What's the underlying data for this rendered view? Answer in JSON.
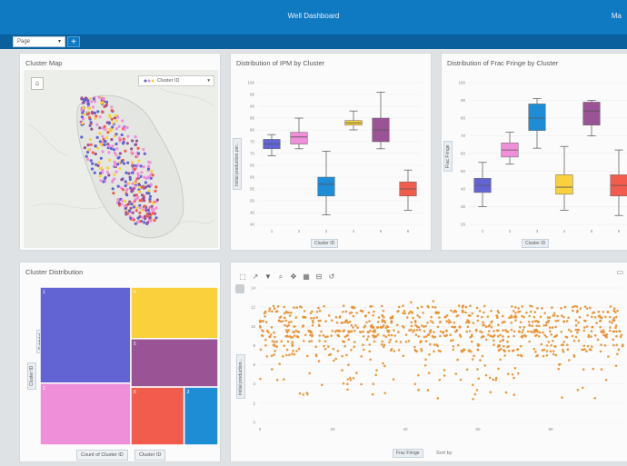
{
  "app": {
    "title": "Well Dashboard",
    "menu_label": "Ma"
  },
  "pages": {
    "selected": "Page",
    "add_icon": "plus-icon"
  },
  "colors": {
    "header": "#0f79c2",
    "cluster1": "#6264d3",
    "cluster2": "#ef8fd9",
    "cluster3": "#1e8dd6",
    "cluster4": "#fad13d",
    "cluster5": "#9a5395",
    "cluster6": "#f25c4c",
    "scatter": "#e8902f"
  },
  "map": {
    "title": "Cluster Map",
    "home_icon": "home-icon",
    "legend_label": "Cluster ID"
  },
  "ipm_chart": {
    "title": "Distribution of IPM by Cluster",
    "ylabel": "Initial production per...",
    "legend": "Cluster ID"
  },
  "frac_chart": {
    "title": "Distribution of Frac Fringe by Cluster",
    "ylabel": "Frac Fringe",
    "legend": "Cluster ID"
  },
  "treemap": {
    "title": "Cluster Distribution",
    "side_label": "Cluster ID",
    "side_label2": "Subtotal",
    "footer_btn1": "Count of Cluster ID",
    "footer_btn2": "Cluster ID"
  },
  "scatter_panel": {
    "toolbar_icons": [
      "select-icon",
      "lasso-icon",
      "filter-icon",
      "zoom-icon",
      "pan-icon",
      "table-icon",
      "clear-icon",
      "reset-icon"
    ],
    "ylabel": "Initial production...",
    "xlabel": "Frac Fringe",
    "x_aux_label": "Sort by",
    "side_icon": "layers-icon"
  },
  "chart_data": [
    {
      "type": "box",
      "categories": [
        "1",
        "2",
        "3",
        "4",
        "5",
        "6"
      ],
      "series": [
        {
          "min": 69,
          "q1": 72,
          "median": 74,
          "q3": 76,
          "max": 78
        },
        {
          "min": 72,
          "q1": 74,
          "median": 77,
          "q3": 79,
          "max": 85
        },
        {
          "min": 44,
          "q1": 52,
          "median": 57,
          "q3": 60,
          "max": 71
        },
        {
          "min": 80,
          "q1": 82,
          "median": 83,
          "q3": 84,
          "max": 88
        },
        {
          "min": 72,
          "q1": 75,
          "median": 80,
          "q3": 85,
          "max": 96
        },
        {
          "min": 46,
          "q1": 52,
          "median": 55,
          "q3": 58,
          "max": 63
        }
      ],
      "yticks": [
        40,
        45,
        50,
        55,
        60,
        65,
        70,
        75,
        80,
        85,
        90,
        95,
        100
      ],
      "ylim": [
        40,
        100
      ]
    },
    {
      "type": "box",
      "categories": [
        "1",
        "2",
        "3",
        "4",
        "5",
        "6"
      ],
      "series": [
        {
          "min": 30,
          "q1": 38,
          "median": 42,
          "q3": 46,
          "max": 55
        },
        {
          "min": 54,
          "q1": 58,
          "median": 62,
          "q3": 66,
          "max": 72
        },
        {
          "min": 63,
          "q1": 73,
          "median": 80,
          "q3": 88,
          "max": 91
        },
        {
          "min": 28,
          "q1": 37,
          "median": 41,
          "q3": 48,
          "max": 64
        },
        {
          "min": 70,
          "q1": 76,
          "median": 84,
          "q3": 89,
          "max": 90
        },
        {
          "min": 25,
          "q1": 36,
          "median": 42,
          "q3": 48,
          "max": 62
        }
      ],
      "yticks": [
        20,
        30,
        40,
        50,
        60,
        70,
        80,
        90,
        100
      ],
      "ylim": [
        20,
        100
      ]
    },
    {
      "type": "treemap",
      "values": [
        {
          "id": "1",
          "value": 31
        },
        {
          "id": "2",
          "value": 20
        },
        {
          "id": "4",
          "value": 16
        },
        {
          "id": "5",
          "value": 15
        },
        {
          "id": "6",
          "value": 11
        },
        {
          "id": "3",
          "value": 7
        }
      ]
    },
    {
      "type": "scatter",
      "xlim": [
        0,
        100
      ],
      "ylim": [
        0,
        14
      ],
      "xticks": [
        0,
        20,
        40,
        60,
        80
      ],
      "yticks": [
        0,
        2,
        4,
        6,
        8,
        10,
        12,
        14
      ],
      "n_points": 900
    }
  ]
}
